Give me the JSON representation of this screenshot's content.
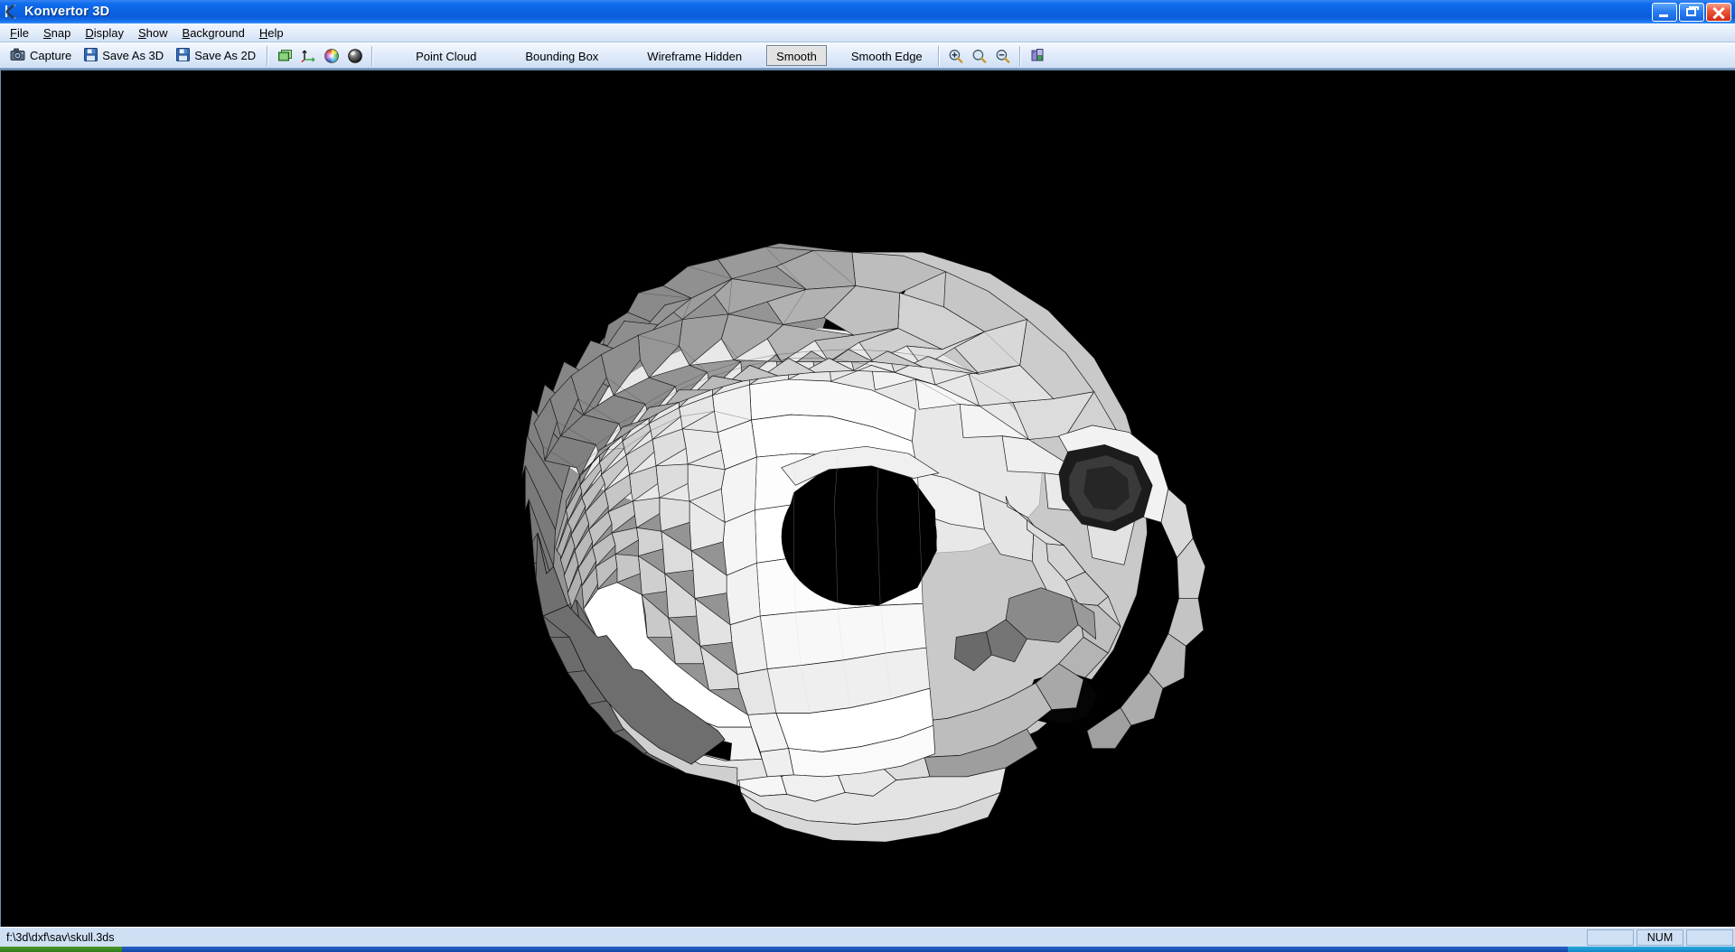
{
  "window": {
    "title": "Konvertor 3D",
    "app_icon": "konvertor-k-icon",
    "controls": [
      {
        "name": "minimize-button",
        "glyph": "minimize-icon"
      },
      {
        "name": "restore-button",
        "glyph": "restore-icon"
      },
      {
        "name": "close-button",
        "glyph": "close-icon"
      }
    ],
    "accent_titlebar": "#0b63e2",
    "accent_close": "#cf2a12"
  },
  "menu": {
    "items": [
      {
        "label": "File",
        "accel": "F"
      },
      {
        "label": "Snap",
        "accel": "S"
      },
      {
        "label": "Display",
        "accel": "D"
      },
      {
        "label": "Show",
        "accel": "S"
      },
      {
        "label": "Background",
        "accel": "B"
      },
      {
        "label": "Help",
        "accel": "H"
      }
    ]
  },
  "toolbar": {
    "capture_label": "Capture",
    "save_3d_label": "Save As 3D",
    "save_2d_label": "Save As 2D",
    "icons": [
      {
        "name": "layers-icon",
        "title": "layers"
      },
      {
        "name": "axis-icon",
        "title": "axis"
      },
      {
        "name": "color-wheel-icon",
        "title": "color wheel"
      },
      {
        "name": "material-sphere-icon",
        "title": "material"
      }
    ],
    "modes": [
      {
        "label": "Point Cloud",
        "checked": false
      },
      {
        "label": "Bounding Box",
        "checked": false
      },
      {
        "label": "Wireframe Hidden",
        "checked": false
      },
      {
        "label": "Smooth",
        "checked": true
      },
      {
        "label": "Smooth Edge",
        "checked": false
      }
    ],
    "zoom_icons": [
      {
        "name": "zoom-in-icon"
      },
      {
        "name": "zoom-actual-icon"
      },
      {
        "name": "zoom-out-icon"
      }
    ],
    "extra_icon": {
      "name": "scene-properties-icon"
    }
  },
  "viewport": {
    "background_color": "#000000",
    "model_name": "skull",
    "render_mode": "Smooth",
    "mesh_fill_light": "#ffffff",
    "mesh_fill_mid": "#b8b8b8",
    "mesh_fill_dark": "#808080"
  },
  "statusbar": {
    "path": "f:\\3d\\dxf\\sav\\skull.3ds",
    "pane_left": "",
    "num_indicator": "NUM",
    "pane_right": ""
  }
}
